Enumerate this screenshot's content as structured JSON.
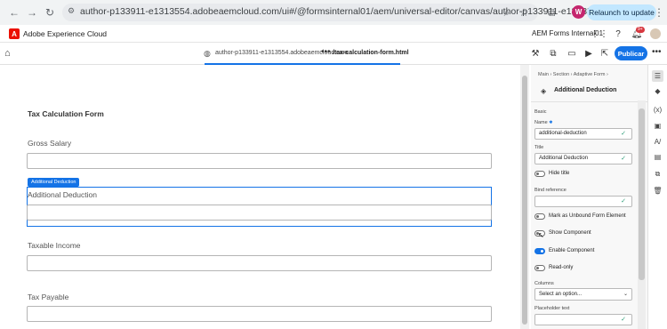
{
  "browser": {
    "url": "author-p133911-e1313554.adobeaemcloud.com/ui#/@formsinternal01/aem/universal-editor/canvas/author-p133911-e13135...",
    "profile_initial": "W",
    "relaunch_label": "Relaunch to update"
  },
  "adobe_bar": {
    "title": "Adobe Experience Cloud",
    "org": "AEM Forms Internal01",
    "notification_count": "9+",
    "logo_letter": "A"
  },
  "toolbar": {
    "host": "author-p133911-e1313554.adobeaemcloud.com",
    "more": "•••",
    "path": "/tax-calculation-form.html",
    "publish_label": "Publicar",
    "overflow": "•••"
  },
  "form": {
    "title": "Tax Calculation Form",
    "fields": [
      {
        "label": "Gross Salary"
      },
      {
        "label": "Additional Deduction"
      },
      {
        "label": "Taxable Income"
      },
      {
        "label": "Tax Payable"
      }
    ],
    "selected_tag": "Additional Deduction"
  },
  "properties": {
    "breadcrumb": "Main  ›  Section  ›  Adaptive Form  ›",
    "component_title": "Additional Deduction",
    "section": "Basic",
    "name_label": "Name",
    "name_required": "✱",
    "name_value": "additional-deduction",
    "title_label": "Title",
    "title_value": "Additional Deduction",
    "bind_label": "Bind reference",
    "bind_value": "",
    "columns_label": "Columns",
    "columns_placeholder": "Select an option...",
    "placeholder_label": "Placeholder text",
    "placeholder_value": "",
    "toggles": [
      {
        "label": "Hide title",
        "on": false
      },
      {
        "label": "Mark as Unbound Form Element",
        "on": false
      },
      {
        "label": "Show Component",
        "on": false
      },
      {
        "label": "Enable Component",
        "on": true
      },
      {
        "label": "Read-only",
        "on": false
      }
    ]
  },
  "colors": {
    "accent": "#1473e6",
    "valid": "#2d9d78",
    "adobe_red": "#eb1000"
  }
}
